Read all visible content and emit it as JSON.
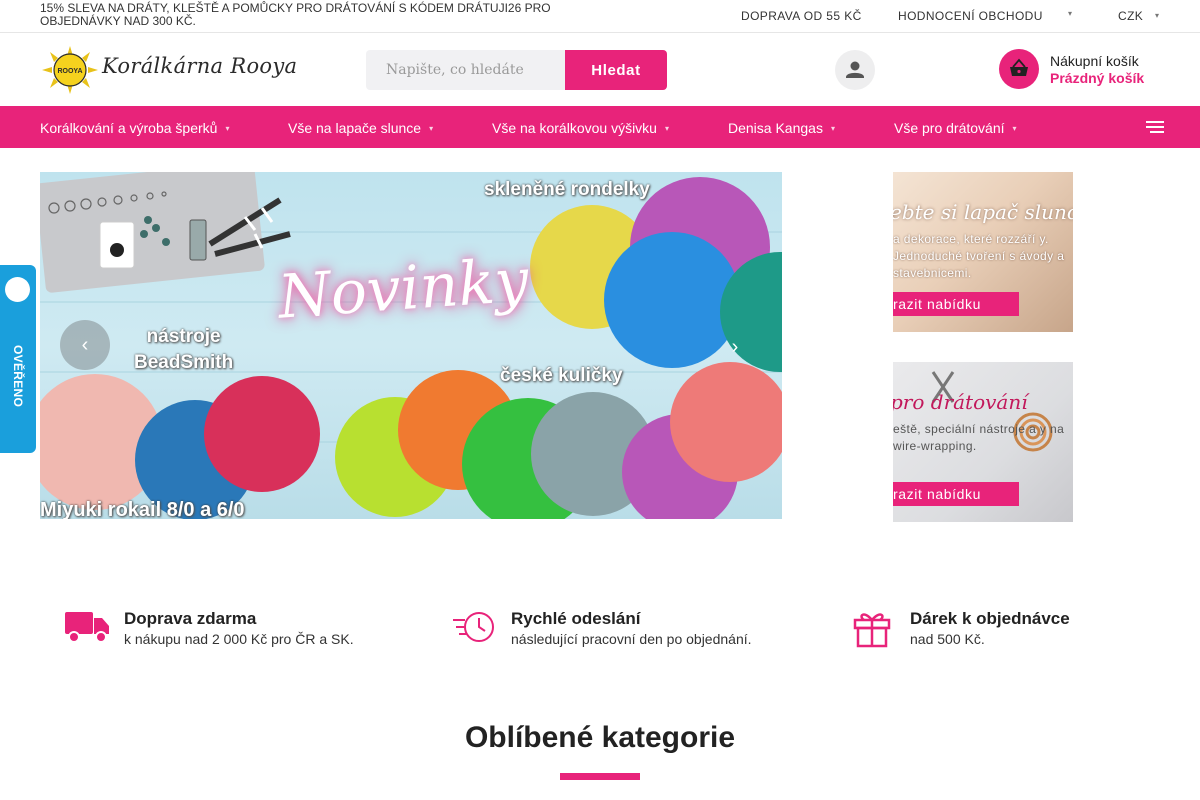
{
  "topbar": {
    "promo": "15% SLEVA NA DRÁTY, KLEŠTĚ A POMŮCKY PRO DRÁTOVÁNÍ S KÓDEM DRÁTUJI26 PRO OBJEDNÁVKY NAD 300 KČ.",
    "shipping_link": "DOPRAVA OD 55 KČ",
    "rating_link": "HODNOCENÍ OBCHODU",
    "currency": "CZK"
  },
  "header": {
    "logo_badge": "ROOYA",
    "logo_text": "Korálkárna Rooya",
    "search_placeholder": "Napište, co hledáte",
    "search_button": "Hledat",
    "cart_title": "Nákupní košík",
    "cart_status": "Prázdný košík"
  },
  "nav": {
    "items": [
      {
        "label": "Korálkování a výroba šperků"
      },
      {
        "label": "Vše na lapače slunce"
      },
      {
        "label": "Vše na korálkovou výšivku"
      },
      {
        "label": "Denisa Kangas"
      },
      {
        "label": "Vše pro drátování"
      }
    ]
  },
  "hero": {
    "title": "Novinky",
    "label_top": "skleněné rondelky",
    "label_tools_line1": "nástroje",
    "label_tools_line2": "BeadSmith",
    "label_czech": "české kuličky",
    "label_bottom": "Miyuki rokail 8/0 a 6/0",
    "prev_icon": "chevron-left-icon",
    "next_icon": "chevron-right-icon",
    "colors": {
      "yellow": "#e6d84a",
      "blue": "#2a8fe0",
      "teal": "#1e9a88",
      "magenta": "#b857b8",
      "orange": "#f07a30",
      "lime": "#b8e030",
      "green": "#35c040",
      "grey": "#8aa3a8",
      "coral": "#ee7a78",
      "pink": "#f0b8b0",
      "cobalt": "#2a78b8",
      "red": "#d8305a"
    }
  },
  "side_banners": [
    {
      "heading": "ebte si lapač slunce",
      "text": "a dekorace, které rozzáří y. Jednoduché tvoření s ávody a stavebnicemi.",
      "button": "razit nabídku"
    },
    {
      "heading": "pro drátování",
      "text": "eště, speciální nástroje a y na wire-wrapping.",
      "button": "razit nabídku"
    }
  ],
  "verified_badge": {
    "text": "OVĚŘENO ZÁKAZNÍKY",
    "color": "#1a9fdc"
  },
  "features": [
    {
      "icon": "truck-icon",
      "title": "Doprava zdarma",
      "desc": "k nákupu nad 2 000 Kč pro ČR a SK."
    },
    {
      "icon": "fast-clock-icon",
      "title": "Rychlé odeslání",
      "desc": "následující pracovní den po objednání."
    },
    {
      "icon": "gift-icon",
      "title": "Dárek k objednávce",
      "desc": "nad 500 Kč."
    }
  ],
  "categories": {
    "heading": "Oblíbené kategorie"
  },
  "colors": {
    "accent": "#e8237a",
    "verified_blue": "#1a9fdc"
  }
}
